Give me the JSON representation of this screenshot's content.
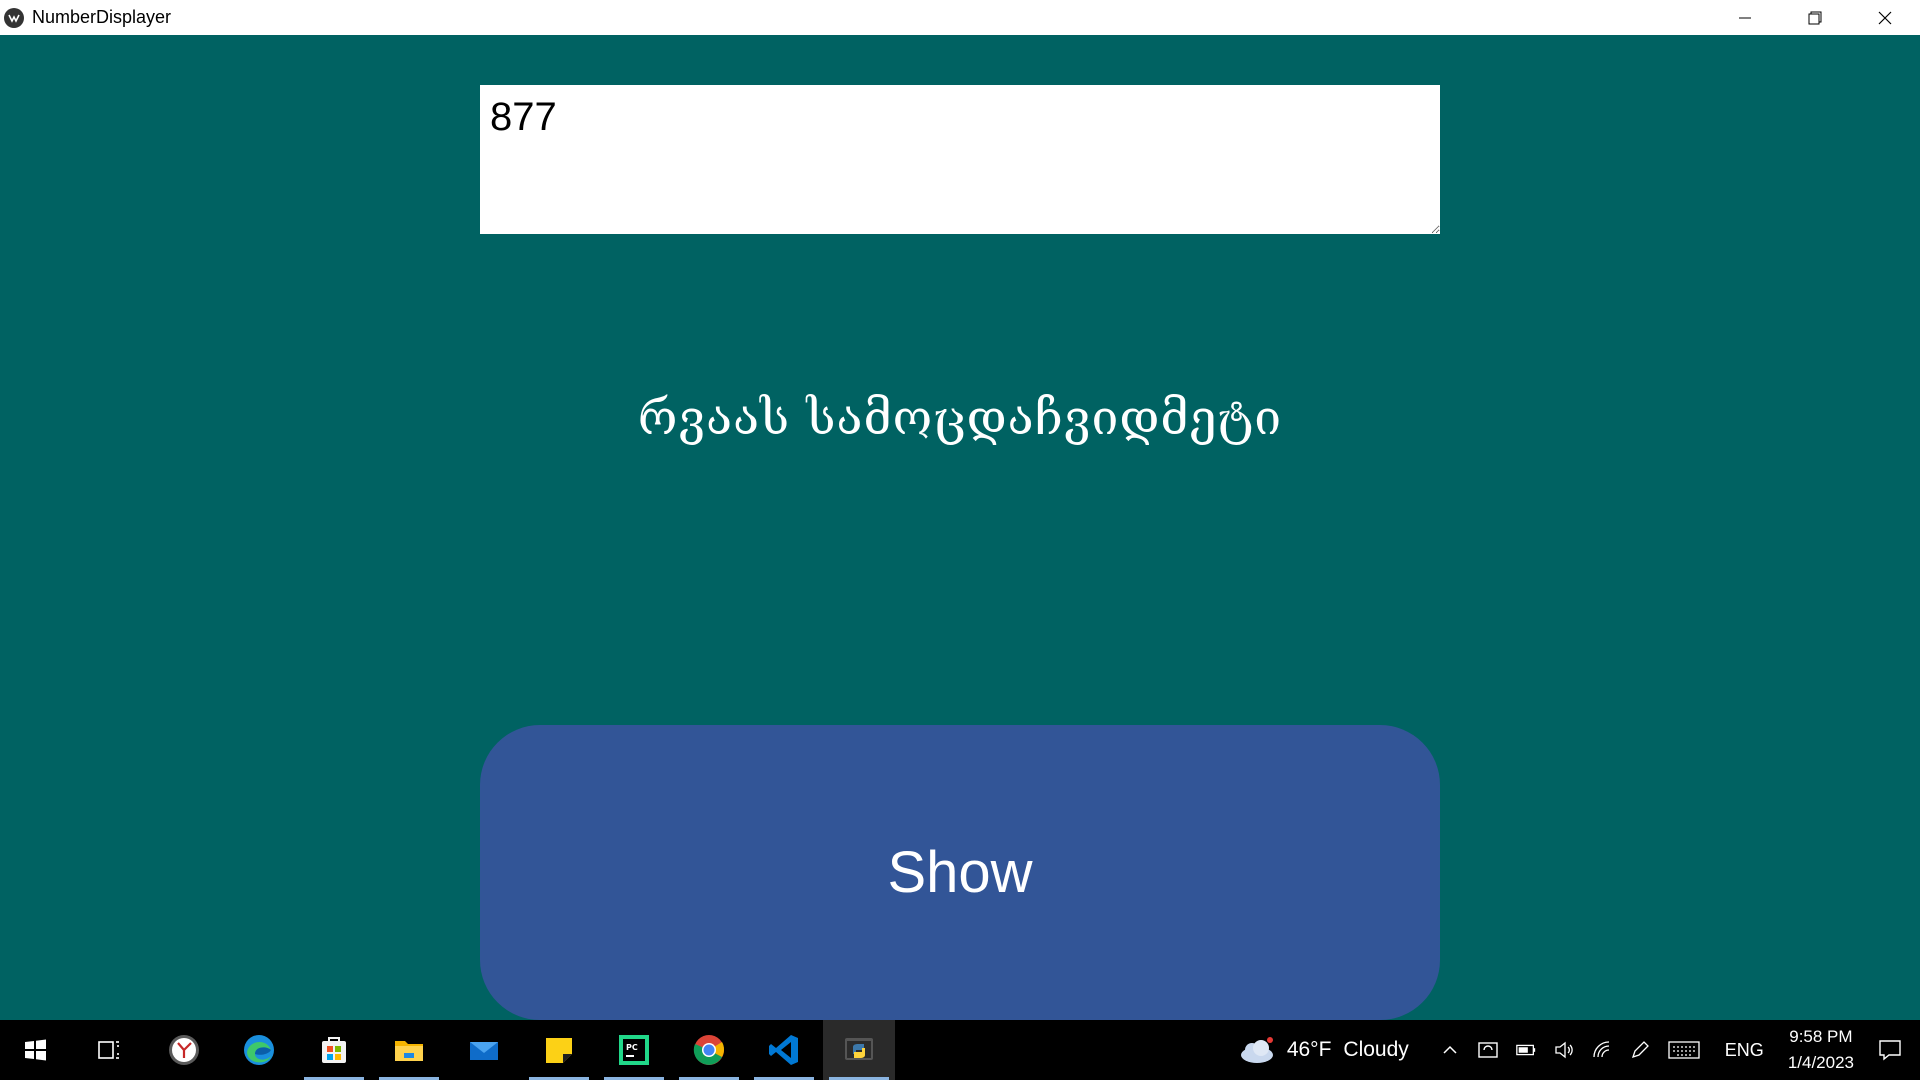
{
  "window": {
    "title": "NumberDisplayer",
    "controls": [
      "minimize-icon",
      "restore-icon",
      "close-icon"
    ]
  },
  "input": {
    "value": "877"
  },
  "result": {
    "text": "რვაას სამოცდაჩვიდმეტი"
  },
  "button": {
    "label": "Show"
  },
  "colors": {
    "background": "#006262",
    "button": "#325597",
    "input_bg": "#ffffff"
  },
  "taskbar": {
    "apps": [
      {
        "name": "start-icon"
      },
      {
        "name": "task-view-icon"
      },
      {
        "name": "clock-app-icon"
      },
      {
        "name": "edge-icon"
      },
      {
        "name": "store-icon"
      },
      {
        "name": "file-explorer-icon"
      },
      {
        "name": "mail-icon"
      },
      {
        "name": "sticky-notes-icon"
      },
      {
        "name": "pycharm-icon"
      },
      {
        "name": "chrome-icon"
      },
      {
        "name": "vscode-icon"
      },
      {
        "name": "python-icon"
      }
    ],
    "weather": {
      "temp": "46°F",
      "condition": "Cloudy"
    },
    "language": "ENG",
    "time": "9:58 PM",
    "date": "1/4/2023"
  }
}
